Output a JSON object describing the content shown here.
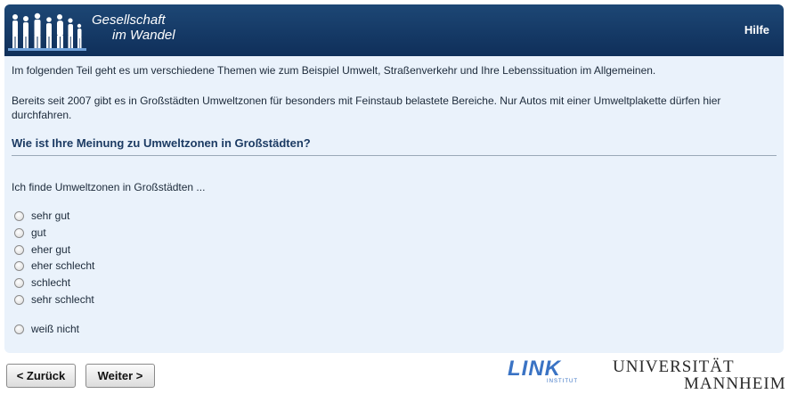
{
  "header": {
    "brand_line1": "Gesellschaft",
    "brand_line2": "im Wandel",
    "help_label": "Hilfe"
  },
  "intro": {
    "paragraph1": "Im folgenden Teil geht es um verschiedene Themen wie zum Beispiel Umwelt, Straßenverkehr und Ihre Lebenssituation im Allgemeinen.",
    "paragraph2": "Bereits seit 2007 gibt es in Großstädten Umweltzonen für besonders mit Feinstaub belastete Bereiche. Nur Autos mit einer Umweltplakette dürfen hier durchfahren."
  },
  "question": {
    "title": "Wie ist Ihre Meinung zu Umweltzonen in Großstädten?",
    "stem": "Ich finde Umweltzonen in Großstädten ...",
    "options": [
      "sehr gut",
      "gut",
      "eher gut",
      "eher schlecht",
      "schlecht",
      "sehr schlecht"
    ],
    "dont_know": "weiß nicht",
    "selected": null
  },
  "navigation": {
    "back_label": "< Zurück",
    "next_label": "Weiter >"
  },
  "logos": {
    "link_word": "LINK",
    "link_sub": "INSTITUT",
    "uni_line1": "UNIVERSITÄT",
    "uni_line2": "MANNHEIM"
  },
  "colors": {
    "header_bg": "#1d4775",
    "content_bg": "#eaf2fb",
    "question_text": "#1c3b63",
    "link_blue": "#3a73c4"
  }
}
